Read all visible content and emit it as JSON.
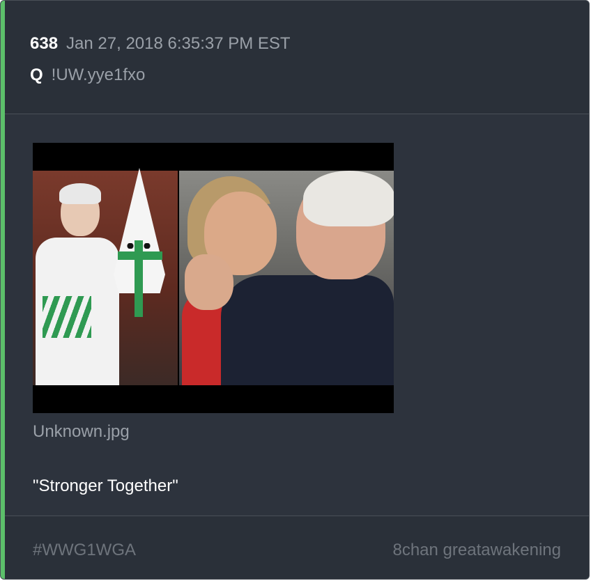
{
  "post": {
    "number": "638",
    "timestamp": "Jan 27, 2018 6:35:37 PM EST",
    "author": "Q",
    "tripcode": "!UW.yye1fxo",
    "attachment": {
      "file_name": "Unknown.jpg"
    },
    "message": "\"Stronger Together\""
  },
  "footer": {
    "hashtag": "#WWG1WGA",
    "source": "8chan greatawakening"
  },
  "colors": {
    "accent": "#5cbf6a",
    "background": "#2d333d",
    "header_background": "#2a3039",
    "text_primary": "#ffffff",
    "text_muted": "#9aa0a8"
  }
}
